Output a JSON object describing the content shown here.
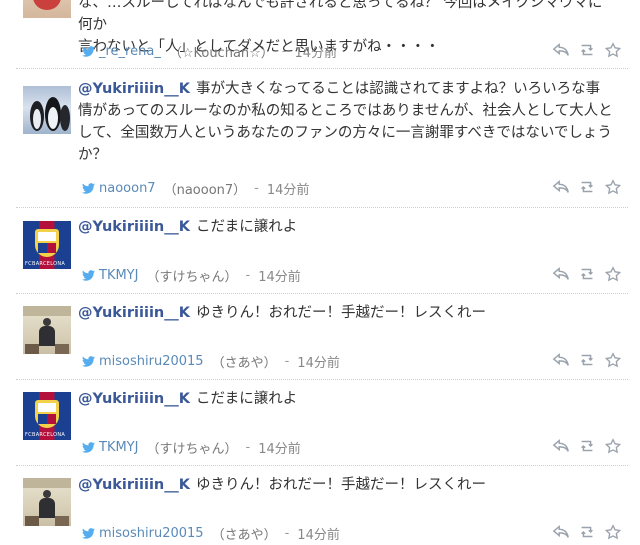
{
  "tweets": [
    {
      "text_lines": [
        "な、…スルーしてればなんでも許されると思ってるね？ 今回はメイクシマウマに何か",
        "言わないと「人」としてダメだと思いますがね・・・・"
      ],
      "username": "_re_rena_",
      "display_name": "（☆Kouchan☆）",
      "dash": "-",
      "time": "14分前"
    },
    {
      "mention": "@Yukiriiiin__K",
      "text": "事が大きくなってることは認識されてますよね？いろいろな事情があってのスルーなのか私の知るところではありませんが、社会人として大人として、全国数万人というあなたのファンの方々に一言謝罪すべきではないでしょうか？",
      "username": "naooon7",
      "display_name": "（naooon7）",
      "dash": "-",
      "time": "14分前"
    },
    {
      "mention": "@Yukiriiiin__K",
      "text": "こだまに譲れよ",
      "username": "TKMYJ",
      "display_name": "（すけちゃん）",
      "dash": "-",
      "time": "14分前",
      "avatar_label": "FCBARCELONA"
    },
    {
      "mention": "@Yukiriiiin__K",
      "text": "ゆきりん！おれだー！手越だー！レスくれー",
      "username": "misoshiru20015",
      "display_name": "（さあや）",
      "dash": "-",
      "time": "14分前"
    },
    {
      "mention": "@Yukiriiiin__K",
      "text": "こだまに譲れよ",
      "username": "TKMYJ",
      "display_name": "（すけちゃん）",
      "dash": "-",
      "time": "14分前",
      "avatar_label": "FCBARCELONA"
    },
    {
      "mention": "@Yukiriiiin__K",
      "text": "ゆきりん！おれだー！手越だー！レスくれー",
      "username": "misoshiru20015",
      "display_name": "（さあや）",
      "dash": "-",
      "time": "14分前"
    }
  ],
  "colors": {
    "link": "#3b5998",
    "username": "#5a8ab8",
    "bird": "#55acee",
    "icon": "#9aa3ad"
  }
}
